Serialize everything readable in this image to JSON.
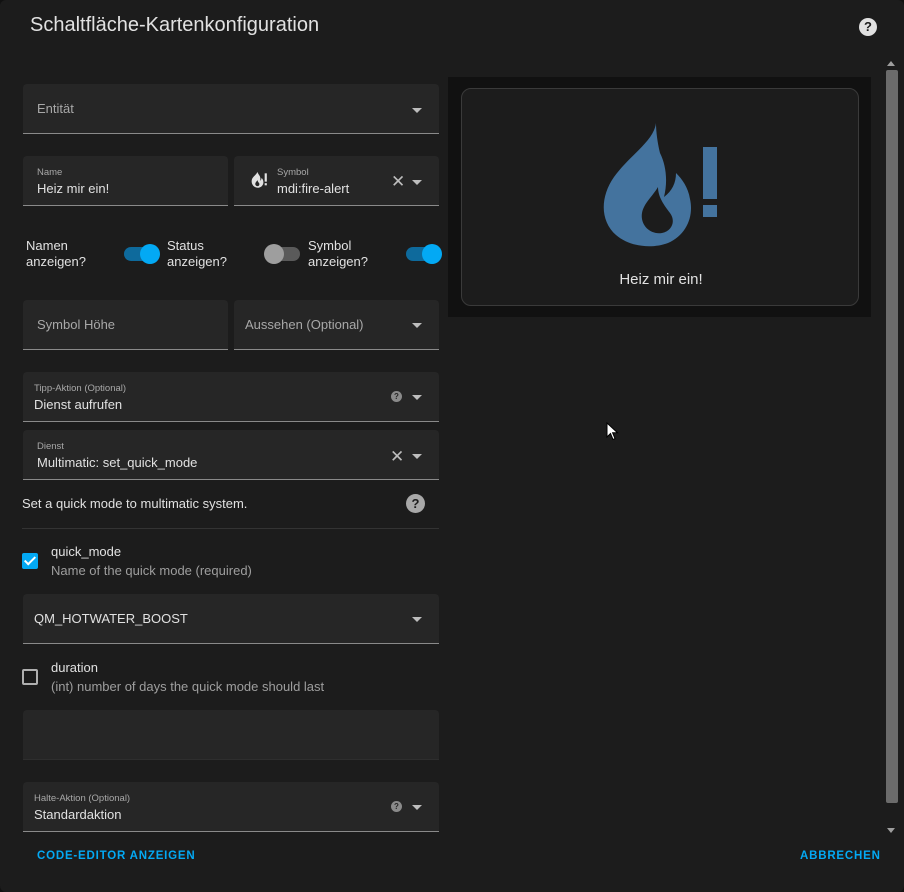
{
  "dialog": {
    "title": "Schaltfläche-Kartenkonfiguration",
    "help_symbol": "?"
  },
  "form": {
    "entity": {
      "label": "Entität"
    },
    "name": {
      "label": "Name",
      "value": "Heiz mir ein!"
    },
    "symbol": {
      "label": "Symbol",
      "value": "mdi:fire-alert",
      "icon": "fire-alert-icon"
    },
    "toggles": [
      {
        "label_line1": "Namen",
        "label_line2": "anzeigen?",
        "on": true
      },
      {
        "label_line1": "Status",
        "label_line2": "anzeigen?",
        "on": false
      },
      {
        "label_line1": "Symbol",
        "label_line2": "anzeigen?",
        "on": true
      }
    ],
    "icon_height": {
      "label": "Symbol Höhe"
    },
    "appearance": {
      "label": "Aussehen (Optional)"
    },
    "tap_action": {
      "label": "Tipp-Aktion (Optional)",
      "value": "Dienst aufrufen"
    },
    "service": {
      "label": "Dienst",
      "value": "Multimatic: set_quick_mode"
    },
    "service_description": "Set a quick mode to multimatic system.",
    "params": [
      {
        "name": "quick_mode",
        "description": "Name of the quick mode (required)",
        "checked": true
      },
      {
        "name": "duration",
        "description": "(int) number of days the quick mode should last",
        "checked": false
      }
    ],
    "quick_mode_value": "QM_HOTWATER_BOOST",
    "hold_action": {
      "label": "Halte-Aktion (Optional)",
      "value": "Standardaktion"
    }
  },
  "preview": {
    "card_name": "Heiz mir ein!",
    "icon": "fire-alert-icon",
    "icon_color": "#44739e"
  },
  "footer": {
    "code_editor_label": "CODE-EDITOR ANZEIGEN",
    "cancel_label": "ABBRECHEN"
  },
  "colors": {
    "accent": "#03a9f4",
    "background": "#1c1c1c",
    "field_background": "#262626"
  }
}
